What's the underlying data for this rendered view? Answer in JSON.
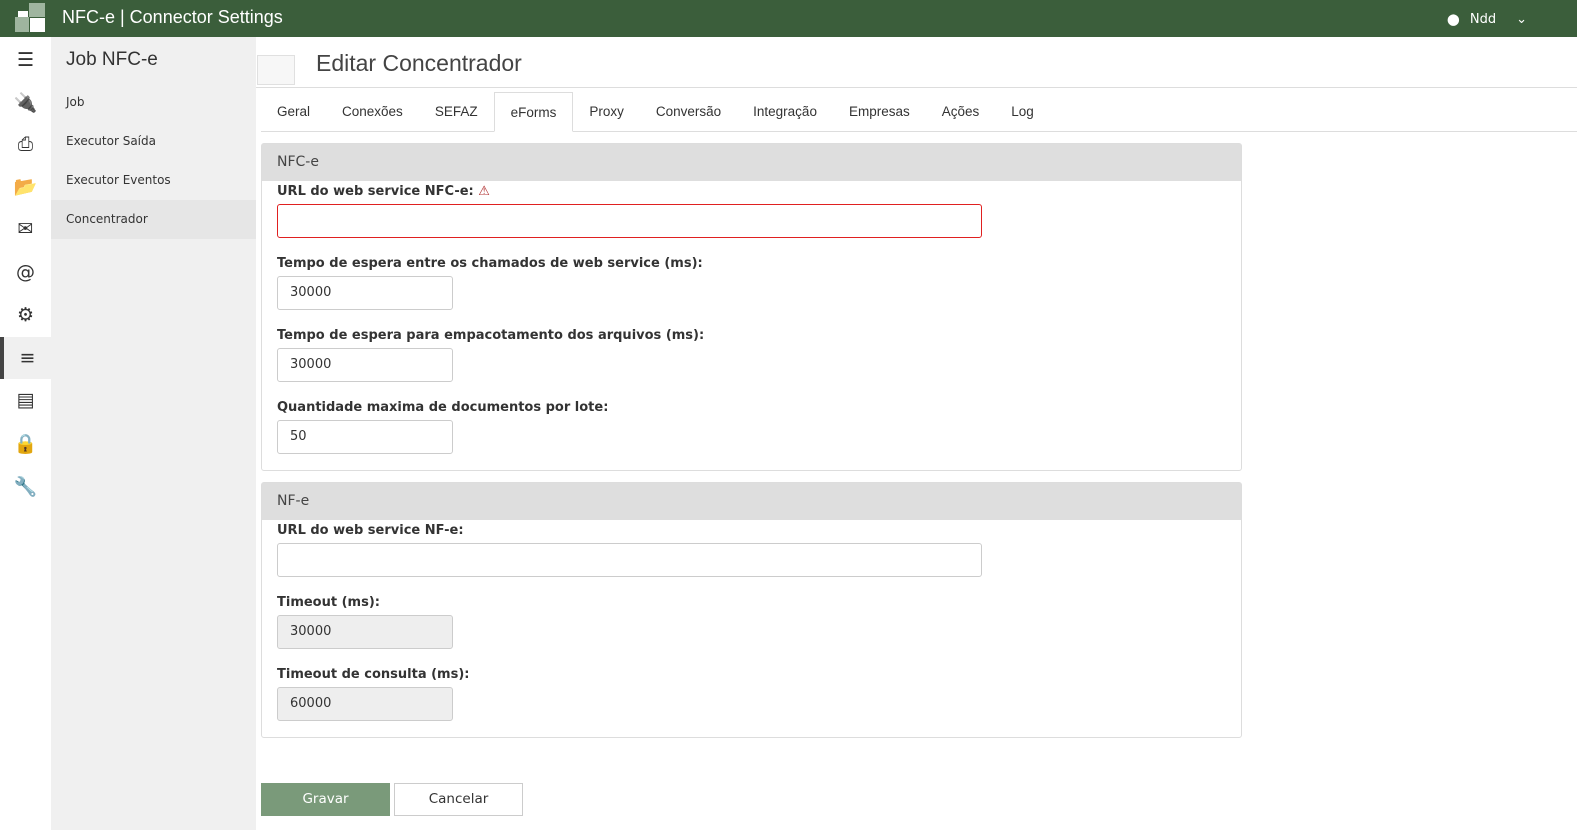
{
  "app": {
    "title": "NFC-e | Connector Settings",
    "user": "Ndd"
  },
  "rail": [
    "menu-icon",
    "plug-icon",
    "printer-icon",
    "folder-icon",
    "envelope-icon",
    "at-icon",
    "gear-icon",
    "sliders-icon",
    "server-icon",
    "lock-icon",
    "wrench-icon"
  ],
  "sidebar": {
    "title": "Job NFC-e",
    "items": [
      {
        "label": "Job"
      },
      {
        "label": "Executor Saída"
      },
      {
        "label": "Executor Eventos"
      },
      {
        "label": "Concentrador"
      }
    ]
  },
  "page": {
    "title": "Editar Concentrador"
  },
  "tabs": [
    "Geral",
    "Conexões",
    "SEFAZ",
    "eForms",
    "Proxy",
    "Conversão",
    "Integração",
    "Empresas",
    "Ações",
    "Log"
  ],
  "nfce": {
    "title": "NFC-e",
    "url_label": "URL do web service NFC-e:",
    "url_value": "",
    "wait_label": "Tempo de espera entre os chamados de web service (ms):",
    "wait_value": "30000",
    "pack_label": "Tempo de espera para empacotamento dos arquivos (ms):",
    "pack_value": "30000",
    "max_label": "Quantidade maxima de documentos por lote:",
    "max_value": "50"
  },
  "nfe": {
    "title": "NF-e",
    "url_label": "URL do web service NF-e:",
    "url_value": "",
    "timeout_label": "Timeout (ms):",
    "timeout_value": "30000",
    "query_label": "Timeout de consulta (ms):",
    "query_value": "60000"
  },
  "buttons": {
    "save": "Gravar",
    "cancel": "Cancelar"
  },
  "colors": {
    "topbar": "#3b5e3b",
    "save": "#7a9a7a",
    "error": "#e02020"
  }
}
